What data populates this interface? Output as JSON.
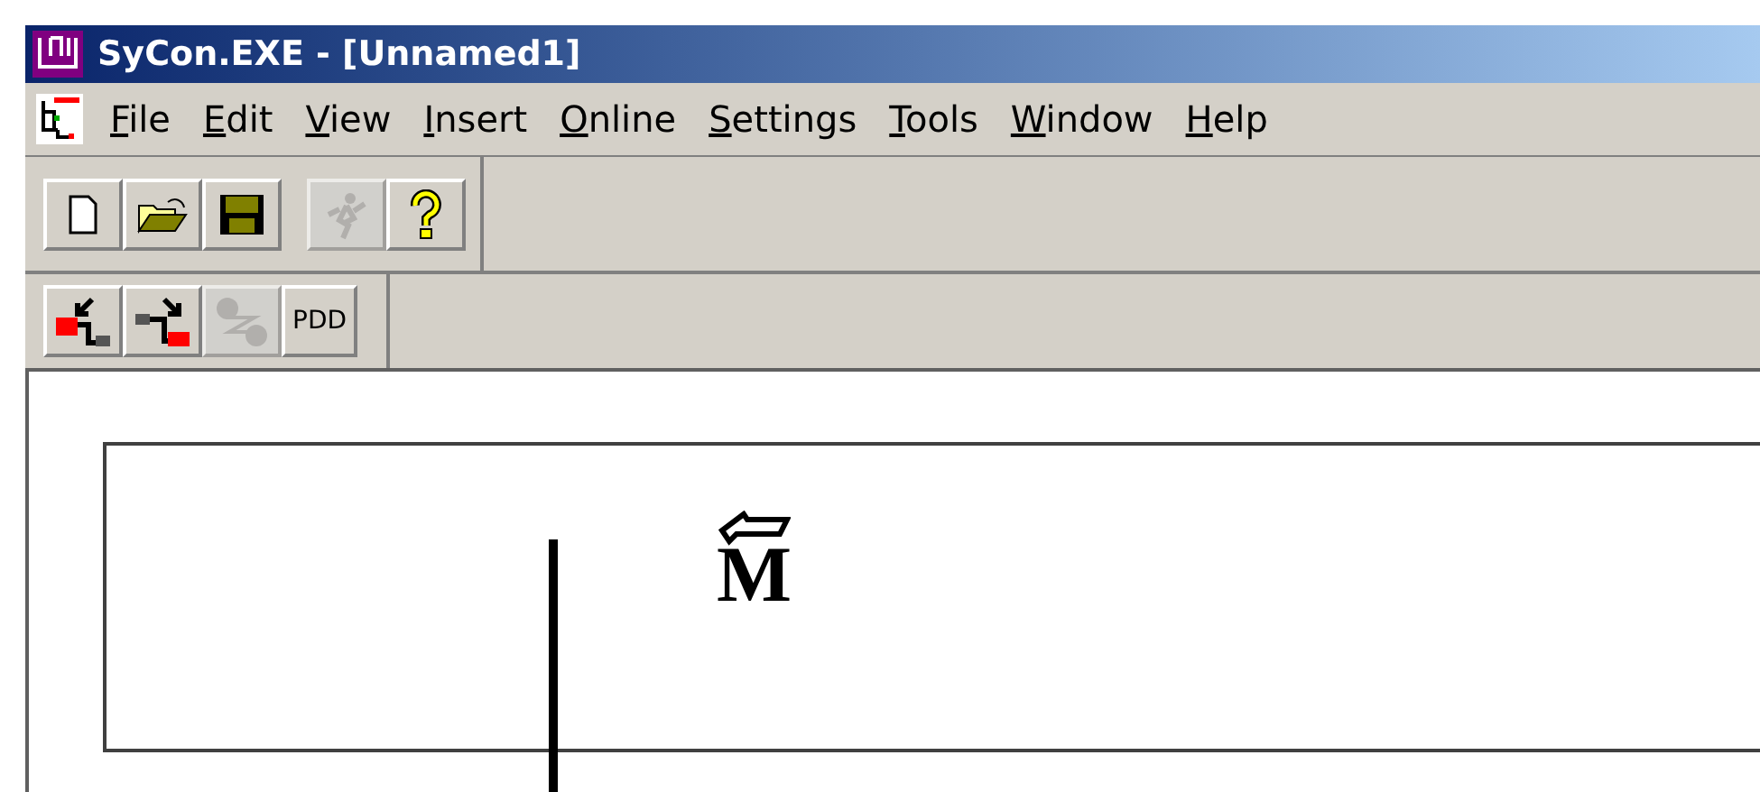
{
  "window": {
    "title": "SyCon.EXE - [Unnamed1]"
  },
  "menu": [
    {
      "key": "F",
      "rest": "ile"
    },
    {
      "key": "E",
      "rest": "dit"
    },
    {
      "key": "V",
      "rest": "iew"
    },
    {
      "key": "I",
      "rest": "nsert"
    },
    {
      "key": "O",
      "rest": "nline"
    },
    {
      "key": "S",
      "rest": "ettings"
    },
    {
      "key": "T",
      "rest": "ools"
    },
    {
      "key": "W",
      "rest": "indow"
    },
    {
      "key": "H",
      "rest": "elp"
    }
  ],
  "toolbar_1": [
    {
      "kind": "new",
      "disabled": false
    },
    {
      "kind": "open",
      "disabled": false
    },
    {
      "kind": "save",
      "disabled": false
    },
    {
      "kind": "run",
      "disabled": true
    },
    {
      "kind": "help",
      "disabled": false
    }
  ],
  "toolbar_2": [
    {
      "kind": "upload",
      "disabled": false
    },
    {
      "kind": "download",
      "disabled": false
    },
    {
      "kind": "link",
      "disabled": true
    },
    {
      "kind": "text",
      "label": "PDD",
      "disabled": false
    }
  ],
  "canvas": {
    "cursor_label": "M"
  }
}
